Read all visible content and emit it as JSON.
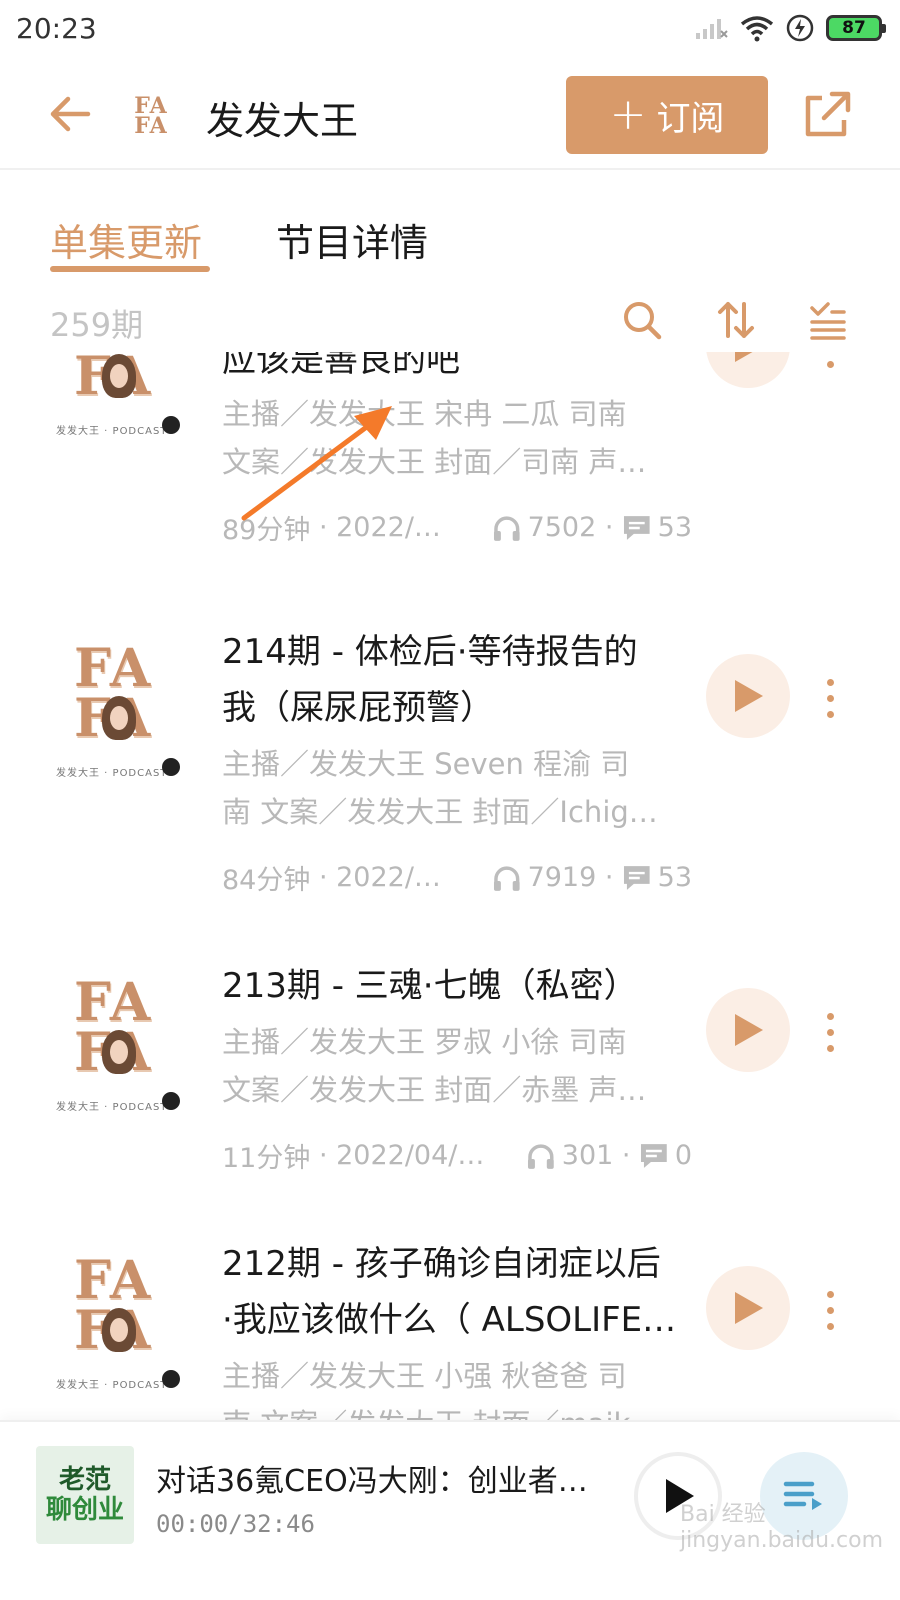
{
  "status_bar": {
    "time": "20:23",
    "battery": "87"
  },
  "header": {
    "title": "发发大王",
    "logo_text_top": "FA",
    "logo_text_bottom": "FA",
    "subscribe_plus": "+",
    "subscribe_label": "订阅"
  },
  "tabs": [
    {
      "label": "单集更新",
      "active": true
    },
    {
      "label": "节目详情",
      "active": false
    }
  ],
  "toolbar": {
    "episode_count": "259期"
  },
  "cover": {
    "letters_top": "FA",
    "letters_bottom": "FA",
    "tagline": "发发大王 · PODCAST"
  },
  "episodes": [
    {
      "title_lines": [
        "应该是善良的吧"
      ],
      "desc_lines": [
        "主播／发发大王 宋冉 二瓜 司南",
        "文案／发发大王 封面／司南 声…"
      ],
      "duration": "89分钟",
      "date": "2022/0…",
      "plays": "7502",
      "comments": "53"
    },
    {
      "title_lines": [
        "214期 - 体检后·等待报告的",
        "我（屎尿屁预警）"
      ],
      "desc_lines": [
        "主播／发发大王 Seven 程渝 司",
        "南 文案／发发大王 封面／Ichig…"
      ],
      "duration": "84分钟",
      "date": "2022/0…",
      "plays": "7919",
      "comments": "53"
    },
    {
      "title_lines": [
        "213期 - 三魂·七魄（私密）"
      ],
      "desc_lines": [
        "主播／发发大王 罗叔 小徐 司南",
        "文案／发发大王 封面／赤墨 声…"
      ],
      "duration": "11分钟",
      "date": "2022/04/14",
      "plays": "301",
      "comments": "0"
    },
    {
      "title_lines": [
        "212期 - 孩子确诊自闭症以后",
        "·我应该做什么（ ALSOLIFE…"
      ],
      "desc_lines": [
        "主播／发发大王 小强 秋爸爸 司",
        "南 文案／发发大王 封面／maik…"
      ],
      "duration": "",
      "date": "",
      "plays": "",
      "comments": ""
    }
  ],
  "player": {
    "cover_line1": "老范",
    "cover_line2": "聊创业",
    "title": "对话36氪CEO冯大刚：创业者…",
    "time": "00:00/32:46"
  },
  "watermark": "Bai 经验 jingyan.baidu.com",
  "colors": {
    "accent": "#d89a6a",
    "muted_text": "#b8b8b8",
    "play_bg": "#fbeee5",
    "annotation": "#f47a2a"
  },
  "icons": {
    "back": "arrow-left",
    "share": "external-link",
    "search": "magnifier",
    "sort": "up-down-arrows",
    "filter": "list-check",
    "plays": "headphones",
    "comments": "chat-bubble",
    "play": "triangle-right",
    "more": "vertical-dots",
    "playlist": "list-lines"
  }
}
